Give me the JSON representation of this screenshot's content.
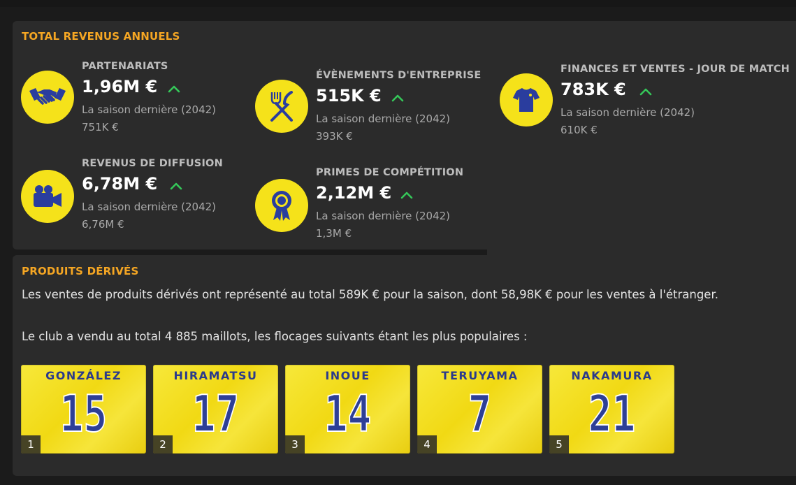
{
  "annual_revenue": {
    "title": "TOTAL REVENUS ANNUELS",
    "items": [
      {
        "label": "PARTENARIATS",
        "value": "1,96M €",
        "prev_label": "La saison dernière (2042)",
        "prev_value": "751K €",
        "icon": "handshake-icon",
        "trend": "up"
      },
      {
        "label": "ÉVÈNEMENTS D'ENTREPRISE",
        "value": "515K €",
        "prev_label": "La saison dernière (2042)",
        "prev_value": "393K €",
        "icon": "cutlery-icon",
        "trend": "up"
      },
      {
        "label": "FINANCES ET VENTES - JOUR DE MATCH",
        "value": "783K €",
        "prev_label": "La saison dernière (2042)",
        "prev_value": "610K €",
        "icon": "shirt-icon",
        "trend": "up"
      },
      {
        "label": "REVENUS DE DIFFUSION",
        "value": "6,78M €",
        "prev_label": "La saison dernière (2042)",
        "prev_value": "6,76M €",
        "icon": "video-camera-icon",
        "trend": "up"
      },
      {
        "label": "PRIMES DE COMPÉTITION",
        "value": "2,12M €",
        "prev_label": "La saison dernière (2042)",
        "prev_value": "1,3M €",
        "icon": "award-ribbon-icon",
        "trend": "up"
      }
    ]
  },
  "merchandise": {
    "title": "PRODUITS DÉRIVÉS",
    "sales_text": "Les ventes de produits dérivés ont représenté au total 589K € pour la saison, dont 58,98K € pour les ventes à l'étranger.",
    "shirts_text": "Le club a vendu au total 4 885 maillots, les flocages suivants étant les plus populaires :",
    "shirts": [
      {
        "rank": "1",
        "name": "GONZÁLEZ",
        "number": "15"
      },
      {
        "rank": "2",
        "name": "HIRAMATSU",
        "number": "17"
      },
      {
        "rank": "3",
        "name": "INOUE",
        "number": "14"
      },
      {
        "rank": "4",
        "name": "TERUYAMA",
        "number": "7"
      },
      {
        "rank": "5",
        "name": "NAKAMURA",
        "number": "21"
      }
    ]
  },
  "colors": {
    "accent": "#f5a623",
    "icon_bg": "#f5e21a",
    "icon_fg": "#2a3d9e",
    "trend_up": "#35c759",
    "shirt": "#f1d914",
    "shirt_text": "#2e3f96"
  }
}
